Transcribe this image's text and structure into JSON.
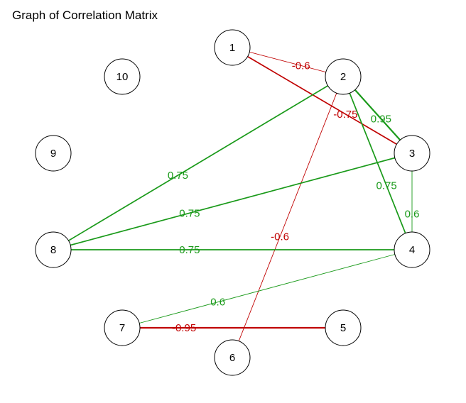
{
  "title": "Graph of Correlation Matrix",
  "colors": {
    "positive": "#1a9a1a",
    "negative": "#c00000",
    "node_fill": "#ffffff",
    "node_stroke": "#000000",
    "background": "#ffffff"
  },
  "nodes": [
    {
      "id": "1",
      "label": "1"
    },
    {
      "id": "2",
      "label": "2"
    },
    {
      "id": "3",
      "label": "3"
    },
    {
      "id": "4",
      "label": "4"
    },
    {
      "id": "5",
      "label": "5"
    },
    {
      "id": "6",
      "label": "6"
    },
    {
      "id": "7",
      "label": "7"
    },
    {
      "id": "8",
      "label": "8"
    },
    {
      "id": "9",
      "label": "9"
    },
    {
      "id": "10",
      "label": "10"
    }
  ],
  "edges": [
    {
      "source": "1",
      "target": "2",
      "weight": -0.6,
      "label": "-0.6"
    },
    {
      "source": "1",
      "target": "3",
      "weight": -0.75,
      "label": "-0.75"
    },
    {
      "source": "2",
      "target": "3",
      "weight": 0.95,
      "label": "0.95"
    },
    {
      "source": "2",
      "target": "4",
      "weight": 0.75,
      "label": "0.75"
    },
    {
      "source": "2",
      "target": "8",
      "weight": 0.75,
      "label": "0.75"
    },
    {
      "source": "2",
      "target": "6",
      "weight": -0.6,
      "label": "-0.6"
    },
    {
      "source": "3",
      "target": "4",
      "weight": 0.6,
      "label": "0.6"
    },
    {
      "source": "3",
      "target": "8",
      "weight": 0.75,
      "label": "0.75"
    },
    {
      "source": "4",
      "target": "8",
      "weight": 0.75,
      "label": "0.75"
    },
    {
      "source": "4",
      "target": "7",
      "weight": 0.6,
      "label": "0.6"
    },
    {
      "source": "7",
      "target": "5",
      "weight": -0.95,
      "label": "-0.95"
    }
  ]
}
